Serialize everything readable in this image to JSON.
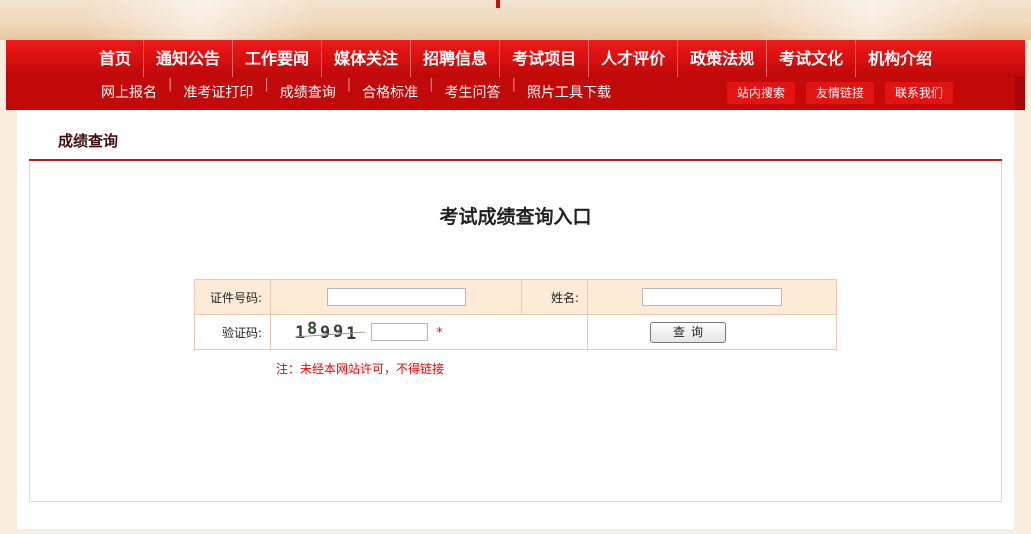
{
  "nav": {
    "items": [
      "首页",
      "通知公告",
      "工作要闻",
      "媒体关注",
      "招聘信息",
      "考试项目",
      "人才评价",
      "政策法规",
      "考试文化",
      "机构介绍"
    ]
  },
  "subnav": {
    "items": [
      "网上报名",
      "准考证打印",
      "成绩查询",
      "合格标准",
      "考生问答",
      "照片工具下载"
    ],
    "buttons": [
      "站内搜索",
      "友情链接",
      "联系我们"
    ]
  },
  "breadcrumb": "成绩查询",
  "page_title": "考试成绩查询入口",
  "form": {
    "id_label": "证件号码:",
    "name_label": "姓名:",
    "captcha_label": "验证码:",
    "captcha_digits": [
      "1",
      "8",
      "9",
      "9",
      "1"
    ],
    "required_mark": "*",
    "query_button": "查询",
    "id_value": "",
    "name_value": "",
    "captcha_value": ""
  },
  "note": "注：未经本网站许可，不得链接",
  "colors": {
    "nav_red": "#d40e0e",
    "accent_red": "#e00000",
    "header_bg": "#fdebd8"
  }
}
